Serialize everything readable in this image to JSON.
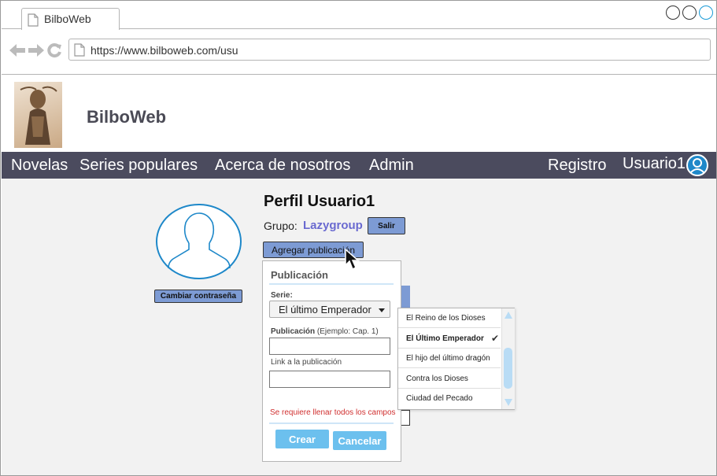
{
  "browser": {
    "tab_title": "BilboWeb",
    "url": "https://www.bilboweb.com/usu"
  },
  "site": {
    "title": "BilboWeb"
  },
  "nav": {
    "novelas": "Novelas",
    "series_populares": "Series populares",
    "acerca": "Acerca de nosotros",
    "admin": "Admin",
    "registro": "Registro",
    "usuario": "Usuario1"
  },
  "profile": {
    "title": "Perfil Usuario1",
    "group_label": "Grupo:",
    "group_name": "Lazygroup",
    "exit_button": "Salir",
    "change_password_button": "Cambiar contraseña",
    "add_publication_button": "Agregar publicación"
  },
  "popup": {
    "title": "Publicación",
    "serie_label": "Serie:",
    "serie_value": "El último Emperador",
    "publicacion_label": "Publicación",
    "publicacion_hint": "(Ejemplo: Cap. 1)",
    "link_label": "Link a la publicación",
    "error": "Se requiere llenar todos los campos",
    "create_button": "Crear",
    "cancel_button": "Cancelar"
  },
  "dropdown": {
    "items": [
      "El Reino de los Dioses",
      "El Último Emperador",
      "El hijo del último dragón",
      "Contra los Dioses",
      "Ciudad del Pecado"
    ],
    "selected_index": 1
  },
  "colors": {
    "navbar": "#4b4b5e",
    "button_primary": "#7d9bd4",
    "button_action": "#6cc0ee",
    "accent_blue": "#1e88c9",
    "group_name": "#6a6ad0",
    "error": "#d03030"
  }
}
